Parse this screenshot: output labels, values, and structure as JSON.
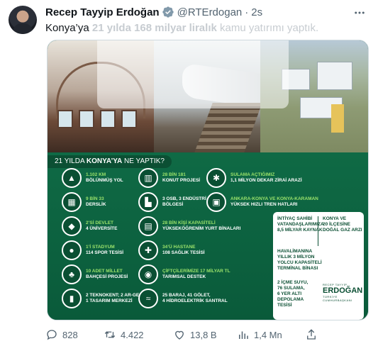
{
  "tweet": {
    "author_name": "Recep Tayyip Erdoğan",
    "handle": "@RTErdogan",
    "separator": "·",
    "time": "2s",
    "text_prefix": "Konya’ya ",
    "text_bold": "21 yılda 168 milyar liralık",
    "text_rest": " kamu yatırımı yaptık."
  },
  "image": {
    "banner_prefix": "21 YILDA ",
    "banner_bold": "KONYA’YA",
    "banner_suffix": " NE YAPTIK?",
    "items": [
      {
        "l1": "1.102 KM",
        "l2": "BÖLÜNMÜŞ YOL"
      },
      {
        "l1": "28 BİN 181",
        "l2": "KONUT PROJESİ"
      },
      {
        "l1": "SULAMA AÇTIĞIMIZ",
        "l2": "1,1 MİLYON DEKAR ZİRAİ ARAZİ"
      },
      {
        "l1": "9 BİN 33",
        "l2": "DERSLİK"
      },
      {
        "l1": "3 OSB, 3 ENDÜSTRİ",
        "l2": "BÖLGESİ"
      },
      {
        "l1": "ANKARA-KONYA VE KONYA-KARAMAN",
        "l2": "YÜKSEK HIZLI TREN HATLARI"
      },
      {
        "l1": "2’Sİ DEVLET",
        "l2": "4 ÜNİVERSİTE"
      },
      {
        "l1": "28 BİN KİŞİ KAPASİTELİ",
        "l2": "YÜKSEKÖĞRENİM YURT BİNALARI"
      },
      {
        "l1": "1’İ STADYUM",
        "l2": "114 SPOR TESİSİ"
      },
      {
        "l1": "34’Ü HASTANE",
        "l2": "108 SAĞLIK TESİSİ"
      },
      {
        "l1": "10 ADET MİLLET",
        "l2": "BAHÇESİ PROJESİ"
      },
      {
        "l1": "ÇİFTÇİLERİMİZE 17 MİLYAR TL",
        "l2": "TARIMSAL DESTEK"
      },
      {
        "l1": "2 TEKNOKENT; 2 AR-GE,",
        "l2": "1 TASARIM MERKEZİ"
      },
      {
        "l1": "25 BARAJ, 41 GÖLET,",
        "l2": "4 HİDROELEKTRİK SANTRAL"
      }
    ],
    "panel": {
      "p1": [
        "İNTİYAÇ SAHİBİ",
        "VATANDAŞLARIMIZA",
        "8,5 MİLYAR KAYNAK"
      ],
      "p2": [
        "KONYA VE",
        "20 İLÇESİNE",
        "DOĞAL GAZ ARZI"
      ],
      "p3": [
        "HAVALİMANINA",
        "YILLIK 3 MİLYON",
        "YOLCU KAPASİTELİ",
        "TERMİNAL BİNASI"
      ],
      "p4": [
        "2 İÇME SUYU,",
        "76 SULAMA,",
        "6 YER ALTI",
        "DEPOLAMA",
        "TESİSİ"
      ]
    },
    "logo_small": "RECEP TAYYİP",
    "logo_main": "ERDOĞAN",
    "logo_sub": "TÜRKİYE CUMHURBAŞKANI"
  },
  "actions": {
    "replies": "828",
    "retweets": "4.422",
    "likes": "13,8 B",
    "views": "1,4 Mn"
  },
  "colors": {
    "verified": "#829aab",
    "infographic_green": "#0f6a45",
    "accent_green": "#9be36b"
  }
}
